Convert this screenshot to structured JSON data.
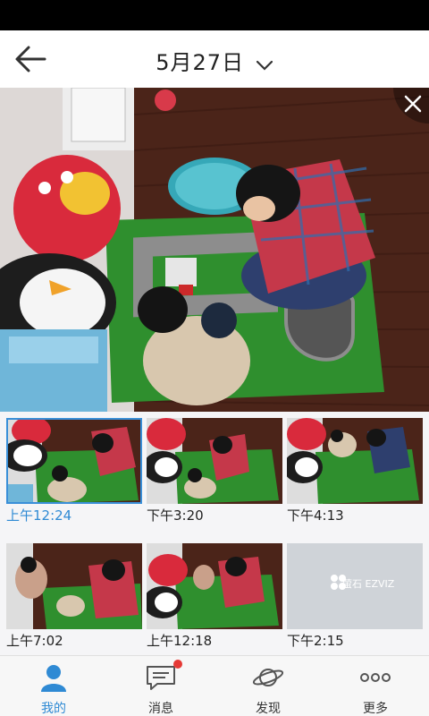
{
  "header": {
    "date": "5月27日"
  },
  "thumbnails": [
    {
      "time": "上午12:24",
      "selected": true
    },
    {
      "time": "下午3:20"
    },
    {
      "time": "下午4:13"
    },
    {
      "time": "上午7:02"
    },
    {
      "time": "上午12:18"
    },
    {
      "time": "下午2:15",
      "placeholder": true,
      "brand": "萤石 EZVIZ"
    }
  ],
  "tabs": [
    {
      "label": "我的",
      "icon": "person-icon",
      "active": true
    },
    {
      "label": "消息",
      "icon": "message-icon",
      "badge": true
    },
    {
      "label": "发现",
      "icon": "planet-icon"
    },
    {
      "label": "更多",
      "icon": "more-icon"
    }
  ],
  "colors": {
    "accent": "#2f8ad4",
    "badge": "#e53935"
  }
}
